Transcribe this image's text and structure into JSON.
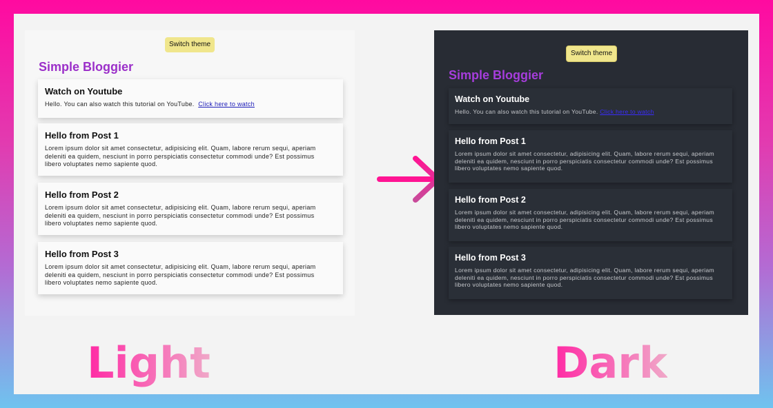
{
  "colors": {
    "outer_gradient_top": "#ff0aa0",
    "outer_gradient_bottom": "#6fc3ef",
    "frame_bg": "#f3f3f3",
    "light_panel_bg": "#f7f7f7",
    "dark_panel_bg": "#282c34",
    "switch_button_bg": "#f0e68c",
    "brand_color": "#9b2fc9",
    "arrow_color": "#ff1493",
    "label_color": "#ff2aa4"
  },
  "light": {
    "switch_label": "Switch theme",
    "brand": "Simple Bloggier",
    "youtube_card": {
      "title": "Watch on Youtube",
      "text": "Hello. You can also watch this tutorial on YouTube.",
      "link": "Click here to watch"
    },
    "posts": [
      {
        "title": "Hello from Post 1",
        "body": "Lorem ipsum dolor sit amet consectetur, adipisicing elit. Quam, labore rerum sequi, aperiam deleniti ea quidem, nesciunt in porro perspiciatis consectetur commodi unde? Est possimus libero voluptates nemo sapiente quod."
      },
      {
        "title": "Hello from Post 2",
        "body": "Lorem ipsum dolor sit amet consectetur, adipisicing elit. Quam, labore rerum sequi, aperiam deleniti ea quidem, nesciunt in porro perspiciatis consectetur commodi unde? Est possimus libero voluptates nemo sapiente quod."
      },
      {
        "title": "Hello from Post 3",
        "body": "Lorem ipsum dolor sit amet consectetur, adipisicing elit. Quam, labore rerum sequi, aperiam deleniti ea quidem, nesciunt in porro perspiciatis consectetur commodi unde? Est possimus libero voluptates nemo sapiente quod."
      }
    ]
  },
  "dark": {
    "switch_label": "Switch theme",
    "brand": "Simple Bloggier",
    "youtube_card": {
      "title": "Watch on Youtube",
      "text": "Hello. You can also watch this tutorial on YouTube.",
      "link": "Click here to watch"
    },
    "posts": [
      {
        "title": "Hello from Post 1",
        "body": "Lorem ipsum dolor sit amet consectetur, adipisicing elit. Quam, labore rerum sequi, aperiam deleniti ea quidem, nesciunt in porro perspiciatis consectetur commodi unde? Est possimus libero voluptates nemo sapiente quod."
      },
      {
        "title": "Hello from Post 2",
        "body": "Lorem ipsum dolor sit amet consectetur, adipisicing elit. Quam, labore rerum sequi, aperiam deleniti ea quidem, nesciunt in porro perspiciatis consectetur commodi unde? Est possimus libero voluptates nemo sapiente quod."
      },
      {
        "title": "Hello from Post 3",
        "body": "Lorem ipsum dolor sit amet consectetur, adipisicing elit. Quam, labore rerum sequi, aperiam deleniti ea quidem, nesciunt in porro perspiciatis consectetur commodi unde? Est possimus libero voluptates nemo sapiente quod."
      }
    ]
  },
  "captions": {
    "light": "Light",
    "dark": "Dark"
  },
  "arrow_icon": "arrow-right-icon"
}
